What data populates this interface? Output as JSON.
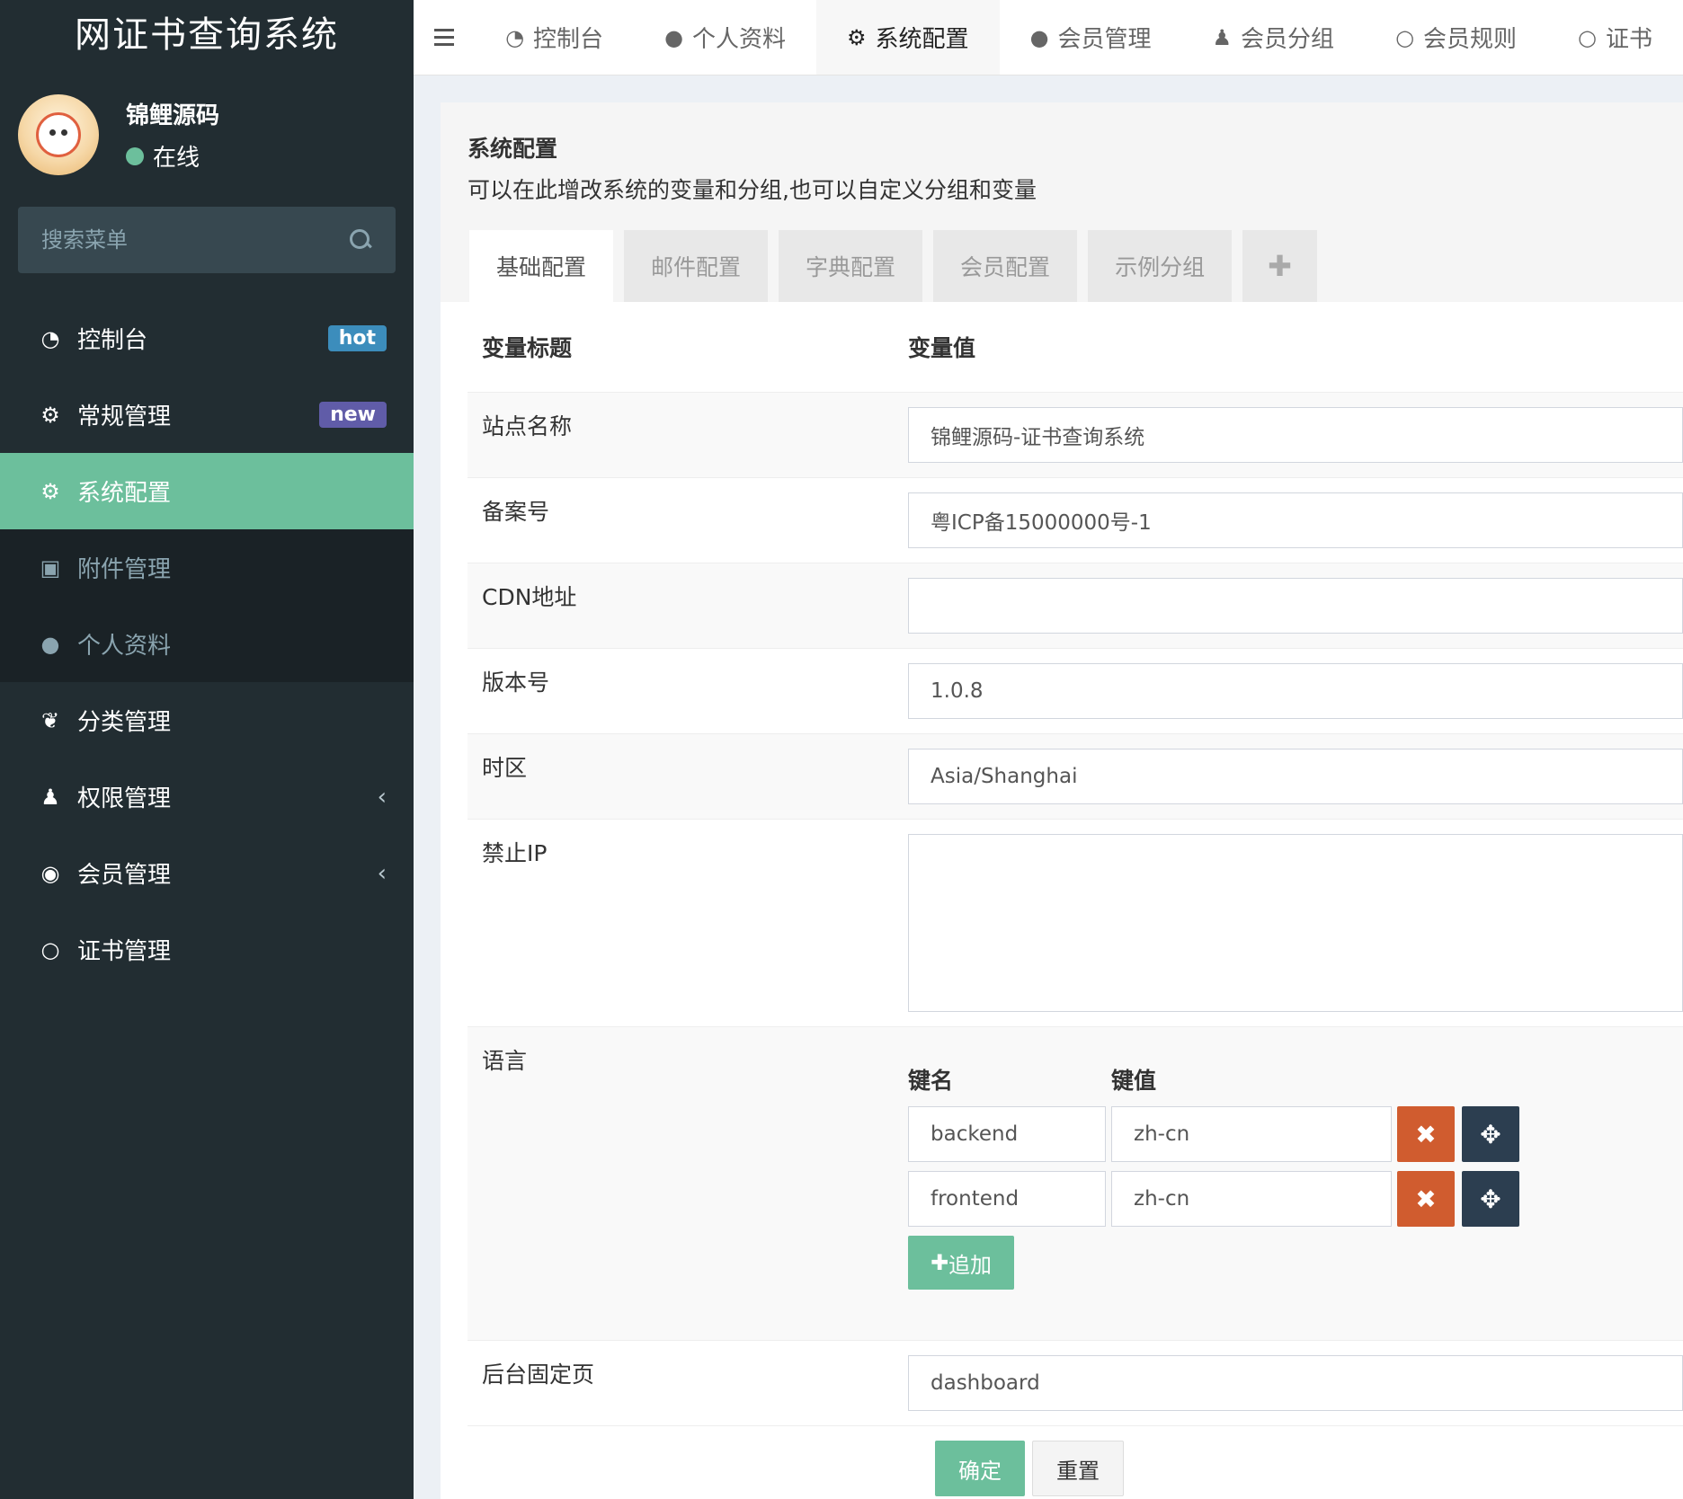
{
  "app": {
    "title": "网证书查询系统"
  },
  "user": {
    "name": "锦鲤源码",
    "status": "在线"
  },
  "search": {
    "placeholder": "搜索菜单"
  },
  "sidebar": {
    "items": [
      {
        "label": "控制台",
        "icon": "dashboard-icon",
        "badge": "hot"
      },
      {
        "label": "常规管理",
        "icon": "cogs-icon",
        "badge": "new"
      },
      {
        "label": "系统配置",
        "icon": "gear-icon"
      },
      {
        "label": "附件管理",
        "icon": "file-image-icon"
      },
      {
        "label": "个人资料",
        "icon": "user-icon"
      },
      {
        "label": "分类管理",
        "icon": "leaf-icon"
      },
      {
        "label": "权限管理",
        "icon": "group-icon"
      },
      {
        "label": "会员管理",
        "icon": "user-circle-icon"
      },
      {
        "label": "证书管理",
        "icon": "circle-icon"
      }
    ]
  },
  "topnav": {
    "tabs": [
      {
        "label": "控制台",
        "icon": "dashboard-icon"
      },
      {
        "label": "个人资料",
        "icon": "user-icon"
      },
      {
        "label": "系统配置",
        "icon": "gear-icon"
      },
      {
        "label": "会员管理",
        "icon": "user-icon"
      },
      {
        "label": "会员分组",
        "icon": "group-icon"
      },
      {
        "label": "会员规则",
        "icon": "circle-icon"
      },
      {
        "label": "证书",
        "icon": "circle-icon"
      }
    ]
  },
  "panel": {
    "title": "系统配置",
    "desc": "可以在此增改系统的变量和分组,也可以自定义分组和变量",
    "tabs": [
      "基础配置",
      "邮件配置",
      "字典配置",
      "会员配置",
      "示例分组"
    ],
    "col_title": "变量标题",
    "col_value": "变量值"
  },
  "fields": {
    "site_name": {
      "label": "站点名称",
      "value": "锦鲤源码-证书查询系统"
    },
    "beian": {
      "label": "备案号",
      "value": "粤ICP备15000000号-1"
    },
    "cdn": {
      "label": "CDN地址",
      "value": ""
    },
    "version": {
      "label": "版本号",
      "value": "1.0.8"
    },
    "timezone": {
      "label": "时区",
      "value": "Asia/Shanghai"
    },
    "forbidden_ip": {
      "label": "禁止IP",
      "value": ""
    },
    "language": {
      "label": "语言",
      "key_header": "键名",
      "value_header": "键值",
      "rows": [
        {
          "key": "backend",
          "value": "zh-cn"
        },
        {
          "key": "frontend",
          "value": "zh-cn"
        }
      ],
      "add_label": "追加"
    },
    "fixed_page": {
      "label": "后台固定页",
      "value": "dashboard"
    }
  },
  "actions": {
    "confirm": "确定",
    "reset": "重置"
  },
  "colors": {
    "accent": "#6cbf9c",
    "sidebar": "#222d32",
    "danger": "#d05c2f",
    "dark": "#2c3e50",
    "hot": "#3c8dbc",
    "new": "#605ca8"
  }
}
